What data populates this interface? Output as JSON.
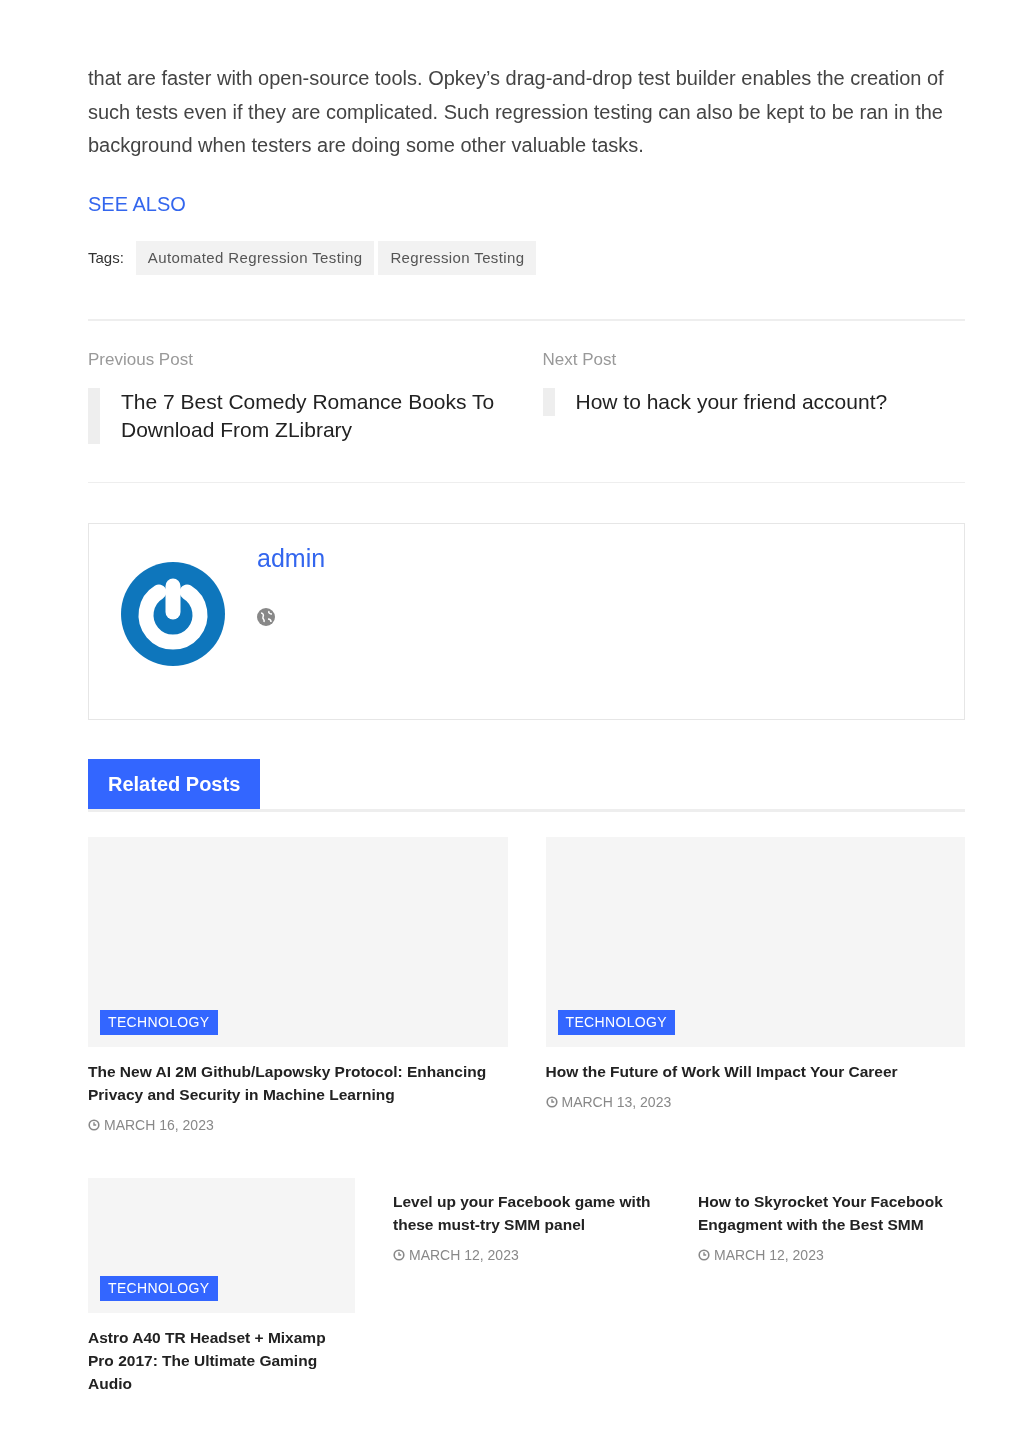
{
  "article": {
    "paragraph": "that are faster with open-source tools. Opkey’s drag-and-drop test builder enables the creation of such tests even if they are complicated. Such regression testing can also be kept to be ran in the background when testers are doing some other valuable tasks.",
    "see_also": "SEE ALSO"
  },
  "tags": {
    "label": "Tags:",
    "items": [
      "Automated Regression Testing",
      "Regression Testing"
    ]
  },
  "post_nav": [
    {
      "label": "Previous Post",
      "title": "The 7 Best Comedy Romance Books To Download From ZLibrary"
    },
    {
      "label": "Next Post",
      "title": "How to hack your friend account?"
    }
  ],
  "author": {
    "name": "admin"
  },
  "related": {
    "heading": "Related Posts",
    "featured": [
      {
        "category": "TECHNOLOGY",
        "title": "The New AI 2M Github/Lapowsky Protocol: Enhancing Privacy and Security in Machine Learning",
        "date": "MARCH 16, 2023"
      },
      {
        "category": "TECHNOLOGY",
        "title": "How the Future of Work Will Impact Your Career",
        "date": "MARCH 13, 2023"
      }
    ],
    "small": [
      {
        "kind": "picture",
        "category": "TECHNOLOGY",
        "title": "Astro A40 TR Headset + Mixamp Pro 2017: The Ultimate Gaming Audio"
      },
      {
        "kind": "text",
        "title": "Level up your Facebook game with these must-try SMM panel",
        "date": "MARCH 12, 2023"
      },
      {
        "kind": "text",
        "title": "How to Skyrocket Your Facebook Engagment with the Best SMM",
        "date": "MARCH 12, 2023"
      }
    ]
  }
}
